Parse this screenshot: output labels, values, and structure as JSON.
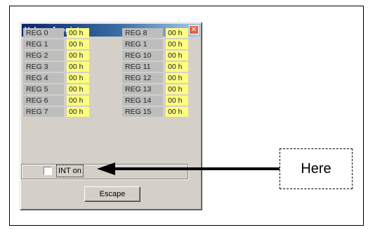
{
  "dialog": {
    "title": "Value of register",
    "close_glyph": "✕",
    "registers_left": [
      {
        "label": "REG 0",
        "value": "00 h"
      },
      {
        "label": "REG 1",
        "value": "00 h"
      },
      {
        "label": "REG 2",
        "value": "00 h"
      },
      {
        "label": "REG 3",
        "value": "00 h"
      },
      {
        "label": "REG 4",
        "value": "00 h"
      },
      {
        "label": "REG 5",
        "value": "00 h"
      },
      {
        "label": "REG 6",
        "value": "00 h"
      },
      {
        "label": "REG 7",
        "value": "00 h"
      }
    ],
    "registers_right": [
      {
        "label": "REG 8",
        "value": "00 h"
      },
      {
        "label": "REG 1",
        "value": "00 h"
      },
      {
        "label": "REG 10",
        "value": "00 h"
      },
      {
        "label": "REG 11",
        "value": "00 h"
      },
      {
        "label": "REG 12",
        "value": "00 h"
      },
      {
        "label": "REG 13",
        "value": "00 h"
      },
      {
        "label": "REG 14",
        "value": "00 h"
      },
      {
        "label": "REG 15",
        "value": "00 h"
      }
    ],
    "int_checkbox_label": "INT on",
    "int_checked": false,
    "escape_label": "Escape"
  },
  "annotation": {
    "callout_text": "Here"
  },
  "colors": {
    "value_bg": "#fdfd80",
    "label_bg": "#bdbdbd",
    "dialog_bg": "#d4d0c8",
    "titlebar_start": "#0a246a",
    "titlebar_end": "#a6caf0",
    "close_button": "#e8603c"
  }
}
